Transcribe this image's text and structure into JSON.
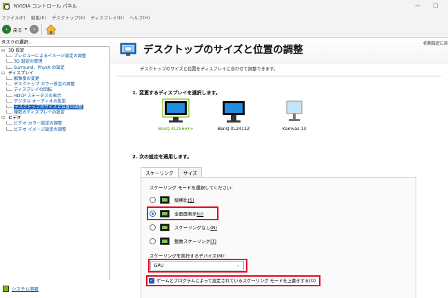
{
  "window": {
    "title": "NVIDIA コントロール パネル",
    "minimize": "—",
    "maximize": "☐"
  },
  "menu": [
    "ファイル(F)",
    "編集(E)",
    "デスクトップ(K)",
    "ディスプレイ(D)",
    "ヘルプ(H)"
  ],
  "toolbar": {
    "back_label": "戻る",
    "back_icon": "arrow-left",
    "forward_icon": "arrow-right",
    "dropdown_glyph": "▾",
    "home_icon": "home"
  },
  "sidebar": {
    "header": "タスクの選択...",
    "tree": [
      {
        "label": "3D 設定",
        "kind": "category"
      },
      {
        "label": "プレビューによるイメージ設定の調整",
        "kind": "leaf"
      },
      {
        "label": "3D 設定の管理",
        "kind": "leaf"
      },
      {
        "label": "Surround、PhysX の設定",
        "kind": "leaf"
      },
      {
        "label": "ディスプレイ",
        "kind": "category"
      },
      {
        "label": "解像度の変更",
        "kind": "leaf"
      },
      {
        "label": "デスクトップ カラー設定の調整",
        "kind": "leaf"
      },
      {
        "label": "ディスプレイの回転",
        "kind": "leaf"
      },
      {
        "label": "HDCP ステータスの表示",
        "kind": "leaf"
      },
      {
        "label": "デジタル オーディオの設定",
        "kind": "leaf"
      },
      {
        "label": "デスクトップのサイズと位置の調整",
        "kind": "leaf",
        "selected": true
      },
      {
        "label": "複数のディスプレイの設定",
        "kind": "leaf"
      },
      {
        "label": "ビデオ",
        "kind": "category"
      },
      {
        "label": "ビデオ カラー設定の調整",
        "kind": "leaf"
      },
      {
        "label": "ビデオ イメージ設定の調整",
        "kind": "leaf"
      }
    ],
    "system_info": "システム情報"
  },
  "main": {
    "title": "デスクトップのサイズと位置の調整",
    "restore_defaults": "初期設定に戻",
    "description": "デスクトップのサイズと位置をディスプレイに合わせて調整できます。",
    "section1": "1. 変更するディスプレイを選択します。",
    "displays": [
      {
        "name": "BenQ XL2566X+",
        "selected": true
      },
      {
        "name": "BenQ XL2411Z",
        "selected": false
      },
      {
        "name": "Kamvas 13",
        "selected": false
      }
    ],
    "section2": "2. 次の設定を適用します。",
    "tabs": [
      {
        "label": "スケーリング",
        "active": true
      },
      {
        "label": "サイズ",
        "active": false
      }
    ],
    "scaling_prompt": "スケーリング モードを選択してください:",
    "scaling_modes": [
      {
        "label": "縦横比",
        "key": "(S)",
        "checked": false
      },
      {
        "label": "全画面表示",
        "key": "(U)",
        "checked": true
      },
      {
        "label": "スケーリングなし",
        "key": "(N)",
        "checked": false
      },
      {
        "label": "整数スケーリング",
        "key": "(T)",
        "checked": false
      }
    ],
    "device_label": "スケーリングを実行するデバイス(M):",
    "device_value": "GPU",
    "device_arrow": "⌄",
    "override_label": "ゲームとプログラムによって設定されているスケーリング モードを上書きする(O)",
    "override_checked": true,
    "checkbox_glyph": "✓",
    "highlight_color": "#e8001a"
  }
}
